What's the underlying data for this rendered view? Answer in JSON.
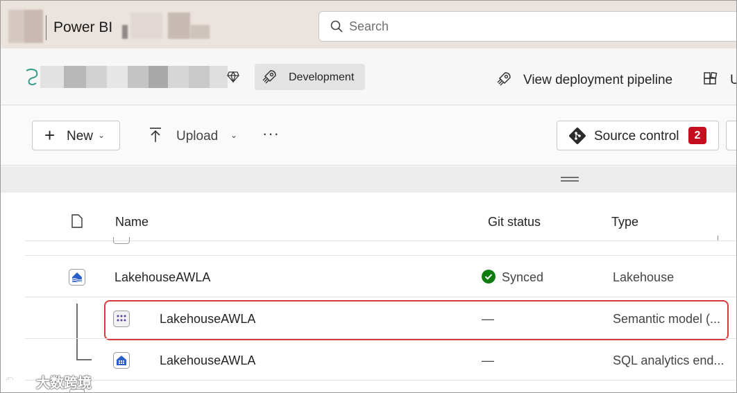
{
  "app": {
    "title": "Power BI"
  },
  "search": {
    "placeholder": "Search"
  },
  "workspace": {
    "environment_label": "Development",
    "pipeline_label": "View deployment pipeline",
    "cut_label": "U"
  },
  "toolbar": {
    "new_label": "New",
    "upload_label": "Upload",
    "more_label": "···",
    "source_control_label": "Source control",
    "source_control_count": "2"
  },
  "table": {
    "columns": {
      "name": "Name",
      "git_status": "Git status",
      "type": "Type"
    },
    "rows": [
      {
        "name": "LakehouseAWLA",
        "git_status": "Synced",
        "type": "Lakehouse",
        "icon": "lakehouse-icon"
      },
      {
        "name": "LakehouseAWLA",
        "git_status": "—",
        "type": "Semantic model (...",
        "icon": "semantic-model-icon"
      },
      {
        "name": "LakehouseAWLA",
        "git_status": "—",
        "type": "SQL analytics end...",
        "icon": "sql-endpoint-icon"
      }
    ]
  },
  "watermark": {
    "text": "大数跨境"
  },
  "colors": {
    "topbar_bg": "#ebe3dd",
    "badge_red": "#c50f1f",
    "synced_green": "#107c10",
    "highlight_red": "#d9393a",
    "item_blue": "#2b5fc7"
  }
}
